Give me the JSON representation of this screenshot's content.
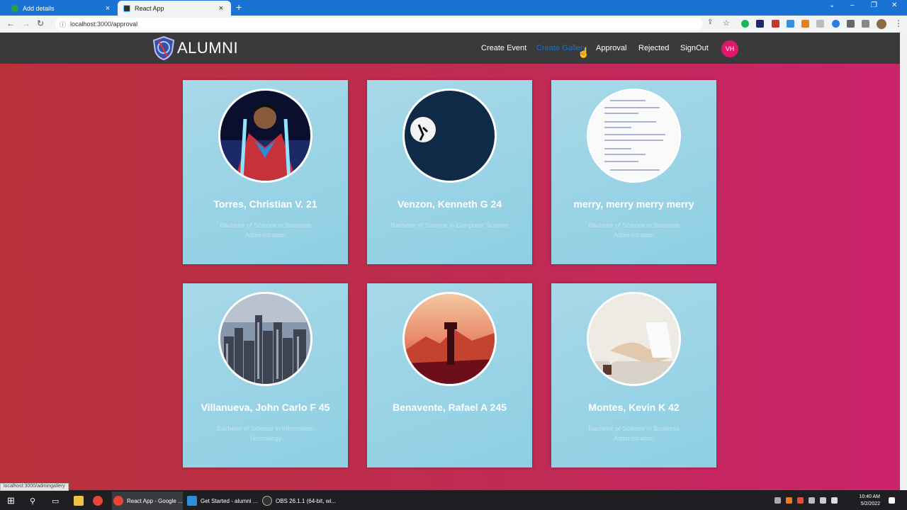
{
  "browser": {
    "tabs": [
      {
        "title": "Add details",
        "active": false
      },
      {
        "title": "React App",
        "active": true
      }
    ],
    "url": "localhost:3000/approval",
    "status_url": "localhost:3000/admingallery"
  },
  "app": {
    "logo_text": "ALUMNI",
    "nav": {
      "create_event": "Create Event",
      "create_gallery": "Create Gallery",
      "approval": "Approval",
      "rejected": "Rejected",
      "signout": "SignOut",
      "avatar_initials": "VH"
    },
    "cards": [
      {
        "name": "Torres, Christian V. 21",
        "course": "Bachelor of Science in Business Administration",
        "photo": "superhero"
      },
      {
        "name": "Venzon, Kenneth G 24",
        "course": "Bachelor of Science in Computer Science",
        "photo": "moon-climber"
      },
      {
        "name": "merry, merry merry merry",
        "course": "Bachelor of Science in Business Administration",
        "photo": "document"
      },
      {
        "name": "Villanueva, John Carlo F 45",
        "course": "Bachelor of Science in Information Technology",
        "photo": "city"
      },
      {
        "name": "Benavente, Rafael A 245",
        "course": "",
        "photo": "firewatch"
      },
      {
        "name": "Montes, Kevin K 42",
        "course": "Bachelor of Science in Business Administration",
        "photo": "handshake"
      }
    ]
  },
  "taskbar": {
    "items": [
      "React App - Google ...",
      "Get Started - alumni ...",
      "OBS 26.1.1 (64-bit, wi..."
    ],
    "time": "10:40 AM",
    "date": "5/2/2022"
  },
  "colors": {
    "tab_strip": "#1a73d4",
    "navbar": "#3a3a3a",
    "card": "#a7d8e8",
    "avatar": "#e0186c",
    "bg_left": "#b8313a",
    "bg_right": "#cc236d"
  }
}
